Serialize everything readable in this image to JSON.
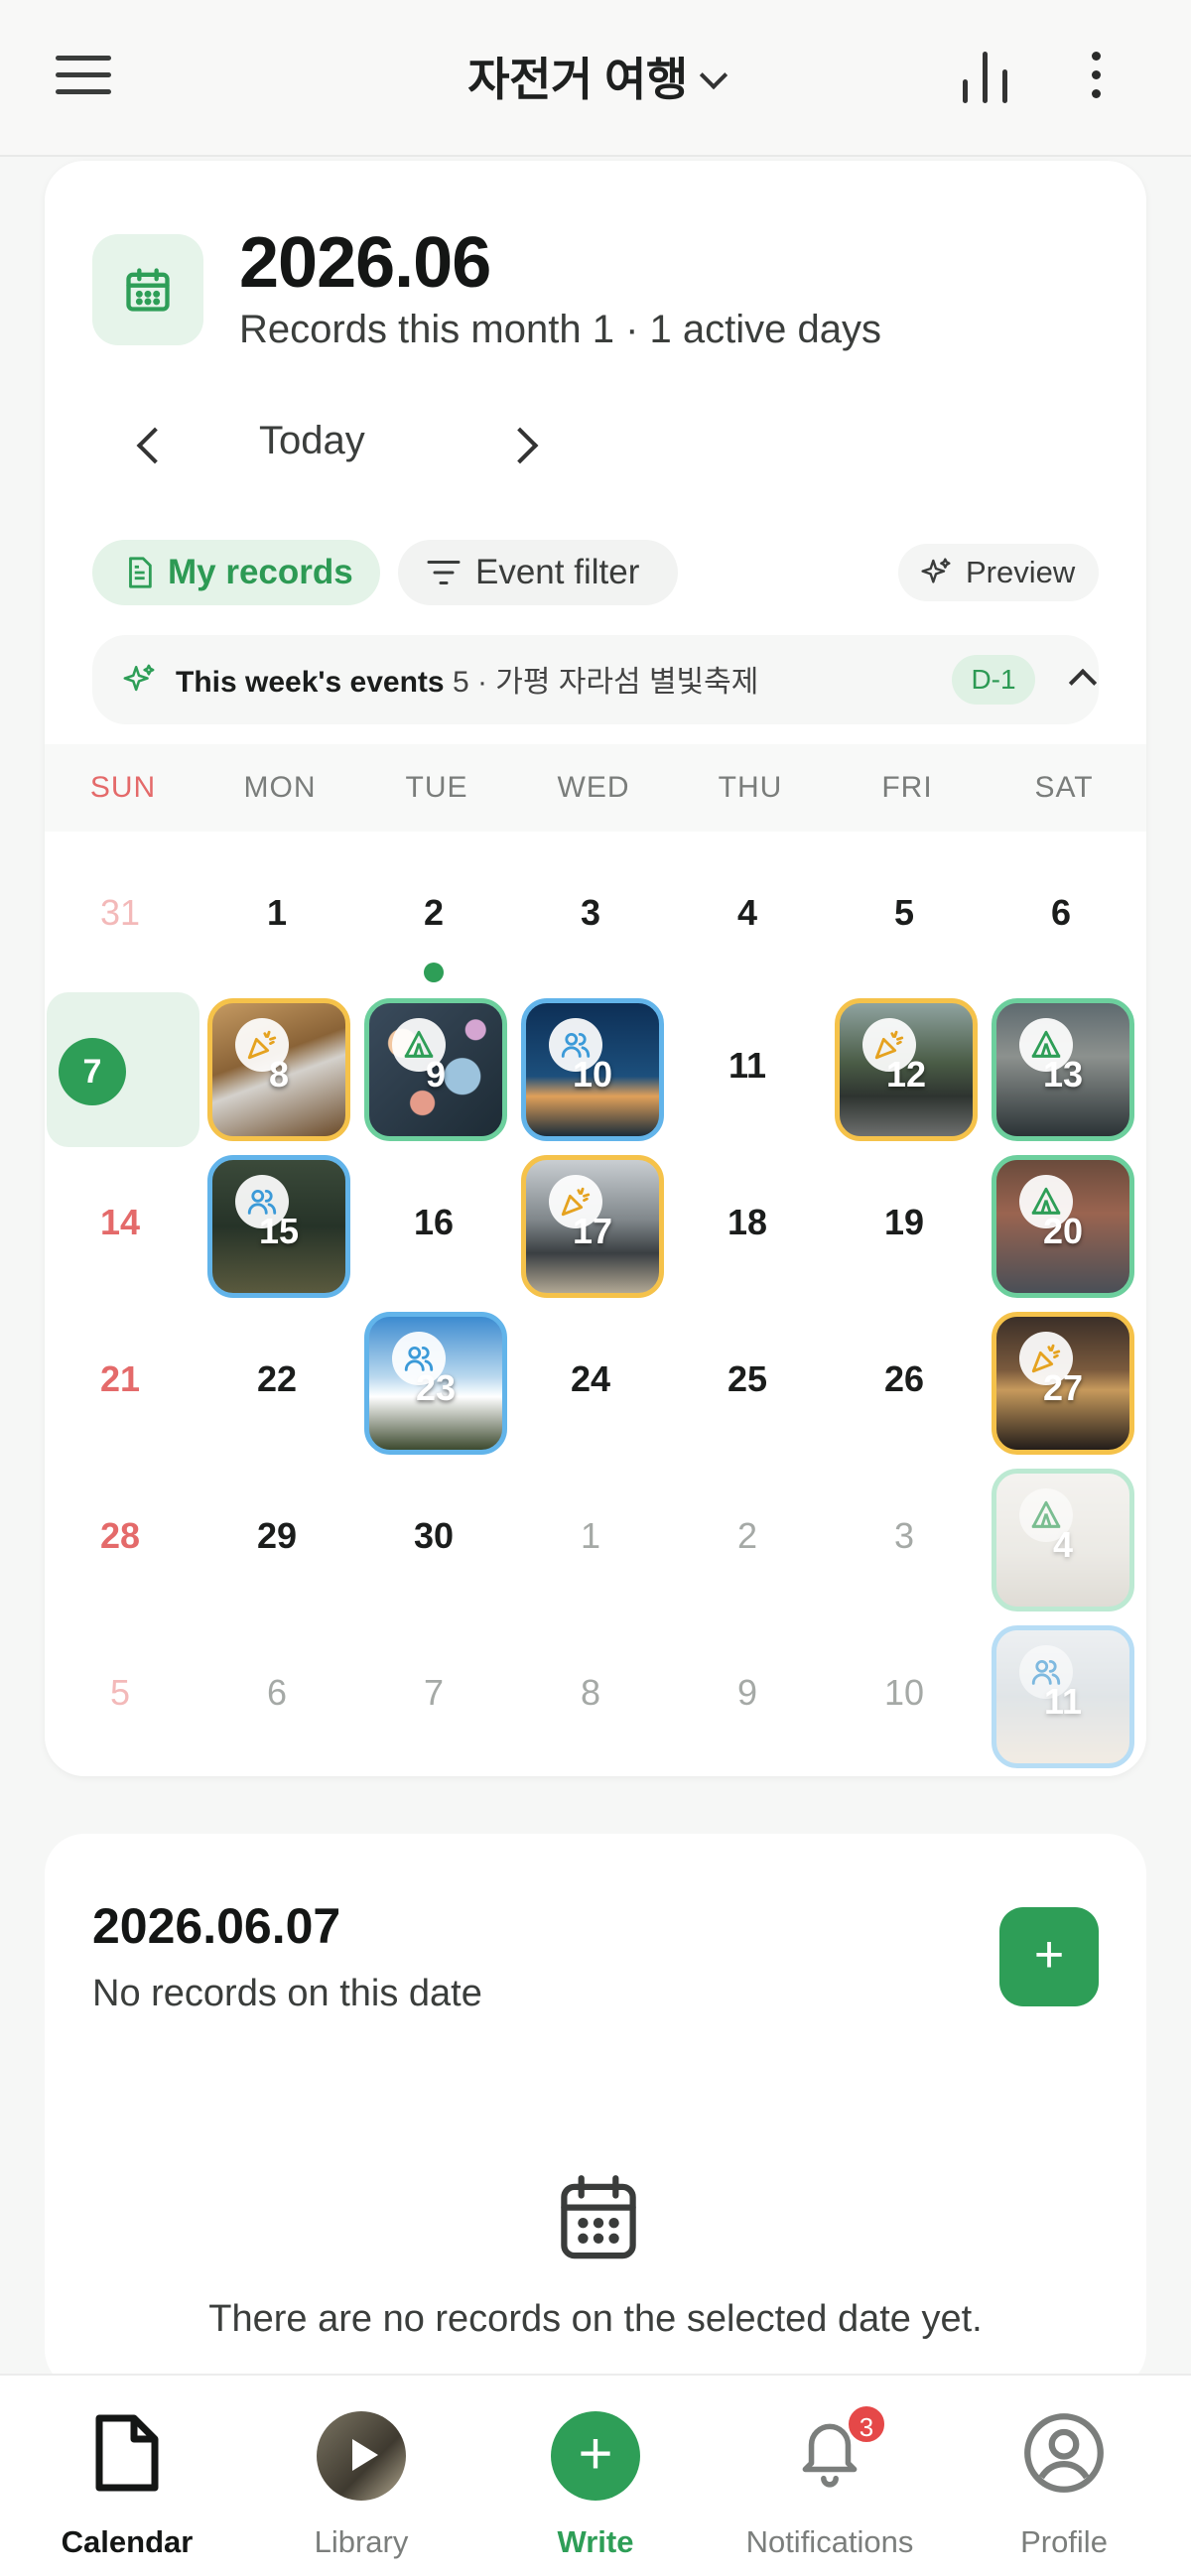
{
  "header": {
    "title": "자전거 여행",
    "menu_icon": "hamburger-menu-icon",
    "stats_icon": "bar-chart-icon",
    "more_icon": "more-vertical-icon"
  },
  "calendar": {
    "month_title": "2026.06",
    "month_summary": "Records this month 1 · 1 active days",
    "today_label": "Today",
    "my_records_label": "My records",
    "event_filter_label": "Event filter",
    "preview_label": "Preview",
    "events_label": "This week's events",
    "events_detail": " 5 · 가평 자라섬 별빛축제",
    "events_dday": "D-1",
    "weekdays": [
      "SUN",
      "MON",
      "TUE",
      "WED",
      "THU",
      "FRI",
      "SAT"
    ],
    "colors": {
      "accent": "#2e9e57",
      "sunday": "#e46a6a",
      "festival": "#f5c24a",
      "camping": "#6ccf9d",
      "group": "#62b4ea"
    },
    "weeks": [
      [
        "31",
        "1",
        "2",
        "3",
        "4",
        "5",
        "6"
      ],
      [
        "7",
        "8",
        "9",
        "10",
        "11",
        "12",
        "13"
      ],
      [
        "14",
        "15",
        "16",
        "17",
        "18",
        "19",
        "20"
      ],
      [
        "21",
        "22",
        "23",
        "24",
        "25",
        "26",
        "27"
      ],
      [
        "28",
        "29",
        "30",
        "1",
        "2",
        "3",
        "4"
      ],
      [
        "5",
        "6",
        "7",
        "8",
        "9",
        "10",
        "11"
      ]
    ],
    "selected_day": "7"
  },
  "detail": {
    "date": "2026.06.07",
    "subtitle": "No records on this date",
    "empty_message": "There are no records on the selected date yet.",
    "add_label": "+"
  },
  "bottom_nav": {
    "tabs": [
      {
        "label": "Calendar",
        "icon": "document-icon"
      },
      {
        "label": "Library",
        "icon": "library-avatar"
      },
      {
        "label": "Write",
        "icon": "plus-circle-icon"
      },
      {
        "label": "Notifications",
        "icon": "bell-icon"
      },
      {
        "label": "Profile",
        "icon": "profile-icon"
      }
    ],
    "notification_count": "3",
    "write_symbol": "+"
  }
}
